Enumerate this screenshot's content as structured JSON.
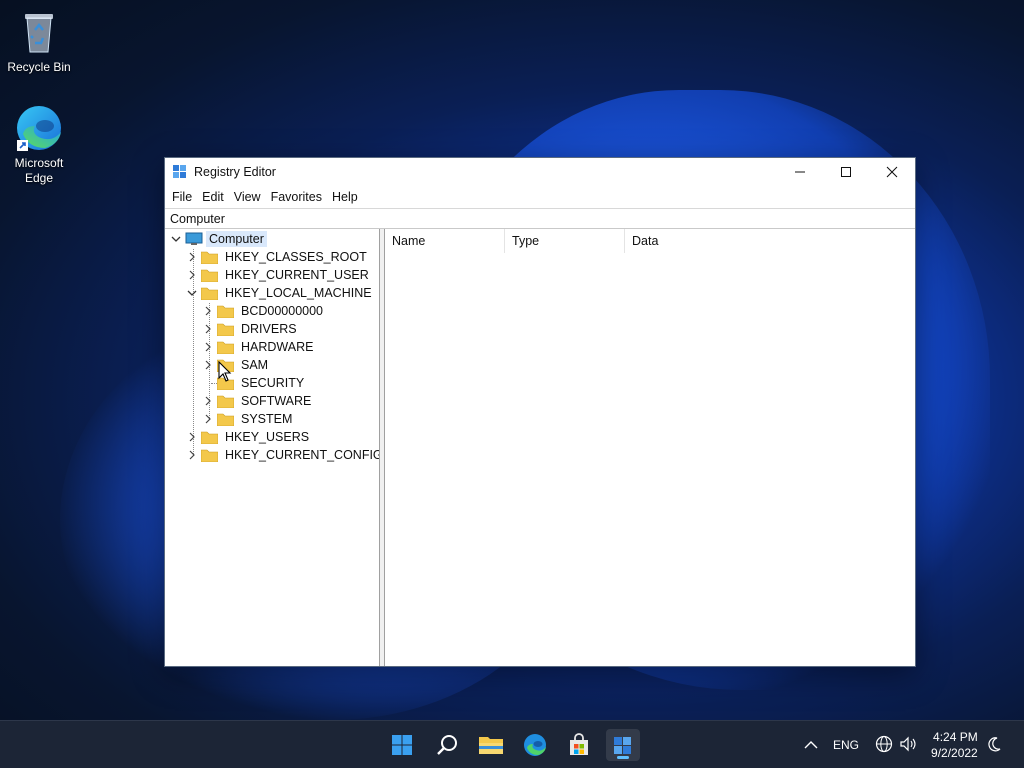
{
  "desktop": {
    "icons": [
      {
        "label": "Recycle Bin",
        "icon": "recycle-bin-icon"
      },
      {
        "label": "Microsoft Edge",
        "icon": "edge-icon"
      }
    ]
  },
  "window": {
    "title": "Registry Editor",
    "controls": {
      "minimize": "minimize-icon",
      "maximize": "maximize-icon",
      "close": "close-icon"
    },
    "menu": [
      "File",
      "Edit",
      "View",
      "Favorites",
      "Help"
    ],
    "address": "Computer",
    "tree": {
      "root": "Computer",
      "hives": [
        {
          "label": "HKEY_CLASSES_ROOT",
          "expanded": false
        },
        {
          "label": "HKEY_CURRENT_USER",
          "expanded": false
        },
        {
          "label": "HKEY_LOCAL_MACHINE",
          "expanded": true,
          "children": [
            "BCD00000000",
            "DRIVERS",
            "HARDWARE",
            "SAM",
            "SECURITY",
            "SOFTWARE",
            "SYSTEM"
          ]
        },
        {
          "label": "HKEY_USERS",
          "expanded": false
        },
        {
          "label": "HKEY_CURRENT_CONFIG",
          "expanded": false
        }
      ]
    },
    "list": {
      "columns": [
        "Name",
        "Type",
        "Data"
      ]
    }
  },
  "taskbar": {
    "apps": [
      "start-icon",
      "search-icon",
      "file-explorer-icon",
      "edge-icon",
      "store-icon",
      "registry-editor-icon"
    ],
    "tray": {
      "language": "ENG",
      "time": "4:24 PM",
      "date": "9/2/2022"
    }
  },
  "colors": {
    "taskbar": "#1c2536",
    "selection": "#d9e8fb",
    "folder": "#f3c84b",
    "accent": "#60c0ff"
  }
}
